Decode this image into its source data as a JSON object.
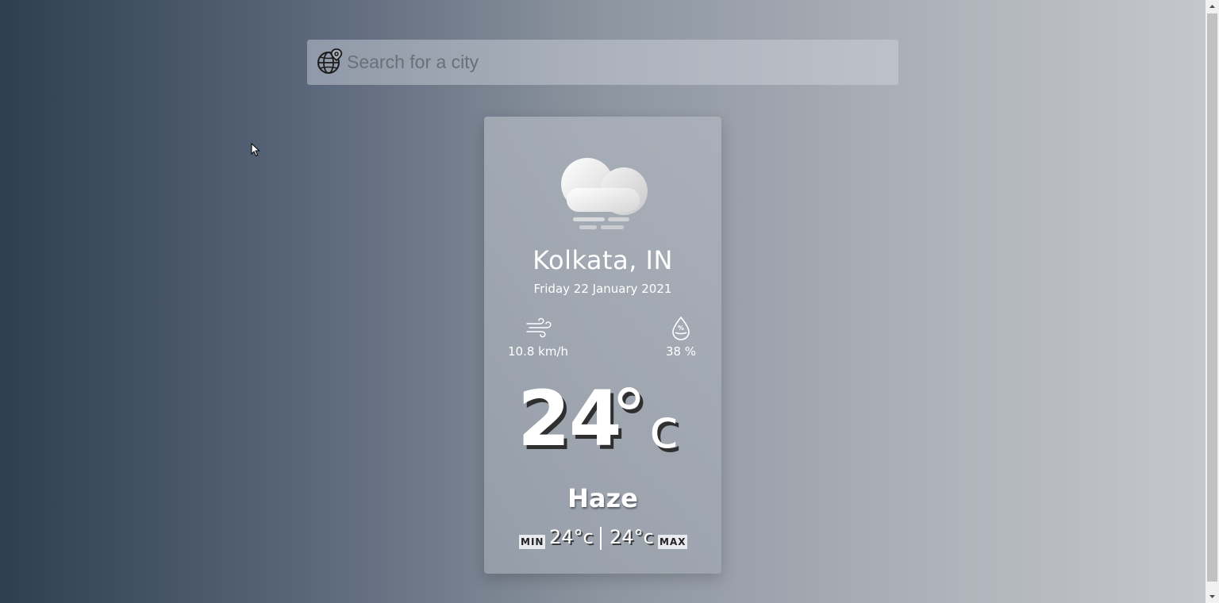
{
  "search": {
    "placeholder": "Search for a city",
    "icon": "globe-location-icon"
  },
  "weather": {
    "icon": "cloud-haze-icon",
    "city": "Kolkata, IN",
    "date": "Friday 22 January 2021",
    "wind": {
      "icon": "wind-icon",
      "value": "10.8 km/h"
    },
    "humidity": {
      "icon": "humidity-drop-icon",
      "value": "38 %"
    },
    "temperature": {
      "value": "24",
      "degree": "°",
      "unit": "c"
    },
    "condition": "Haze",
    "min": {
      "label": "MIN",
      "value": "24°c"
    },
    "max": {
      "label": "MAX",
      "value": "24°c"
    }
  },
  "colors": {
    "gradient_start": "#2f3e51",
    "gradient_end": "#c4c7cb",
    "text": "#ffffff"
  }
}
